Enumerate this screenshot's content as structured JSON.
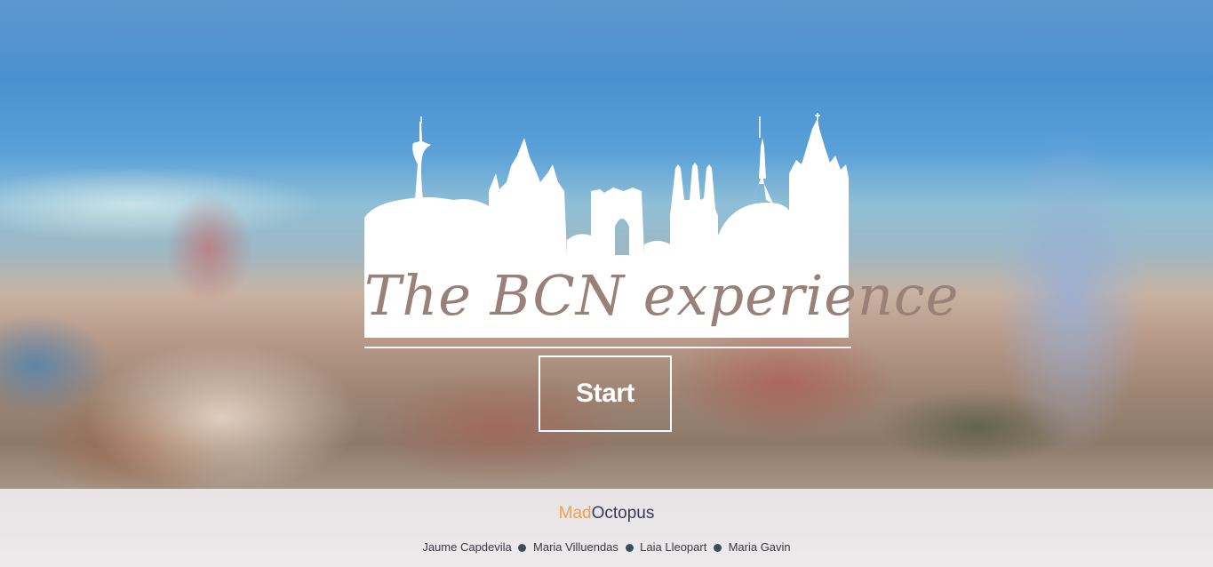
{
  "hero": {
    "logo_title": "The BCN experience",
    "start_label": "Start"
  },
  "footer": {
    "brand_first": "Mad",
    "brand_second": "Octopus",
    "authors": [
      "Jaume Capdevila",
      "Maria Villuendas",
      "Laia Lleopart",
      "Maria Gavin"
    ]
  },
  "colors": {
    "brand_first": "#f0a050",
    "brand_second": "#35395a",
    "logo_text": "#9a8178",
    "footer_bg": "#eeecee"
  },
  "icons": {
    "skyline": "barcelona-skyline-icon",
    "separator": "bullet-dot-icon"
  }
}
